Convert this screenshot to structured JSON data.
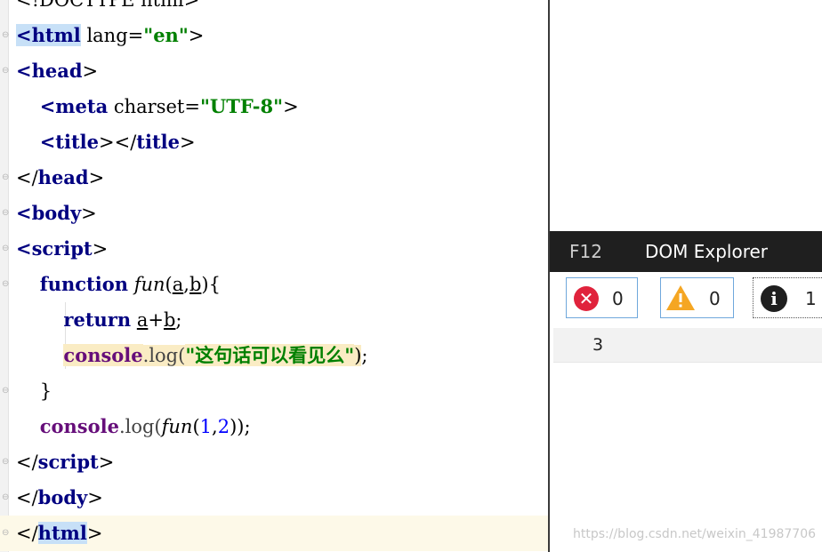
{
  "editor": {
    "lines": [
      {
        "fold": "",
        "parts": [
          [
            "attr",
            "<!DOCTYPE html>"
          ]
        ]
      },
      {
        "fold": "⊖",
        "parts": [
          [
            "tag tag-sel",
            "<html"
          ],
          [
            "attr",
            " lang="
          ],
          [
            "str",
            "\"en\""
          ],
          [
            "attr",
            ">"
          ]
        ]
      },
      {
        "fold": "⊖",
        "parts": [
          [
            "tag",
            "<head"
          ],
          [
            "attr",
            ">"
          ]
        ]
      },
      {
        "fold": "",
        "parts": [
          [
            "attr",
            "    "
          ],
          [
            "tag",
            "<meta"
          ],
          [
            "attr",
            " charset="
          ],
          [
            "str",
            "\"UTF-8\""
          ],
          [
            "attr",
            ">"
          ]
        ]
      },
      {
        "fold": "",
        "parts": [
          [
            "attr",
            "    "
          ],
          [
            "tag",
            "<title"
          ],
          [
            "attr",
            "></"
          ],
          [
            "tag",
            "title"
          ],
          [
            "attr",
            ">"
          ]
        ]
      },
      {
        "fold": "⊖",
        "parts": [
          [
            "attr",
            "</"
          ],
          [
            "tag",
            "head"
          ],
          [
            "attr",
            ">"
          ]
        ]
      },
      {
        "fold": "⊖",
        "parts": [
          [
            "tag",
            "<body"
          ],
          [
            "attr",
            ">"
          ]
        ]
      },
      {
        "fold": "⊖",
        "parts": [
          [
            "tag",
            "<script"
          ],
          [
            "attr",
            ">"
          ]
        ]
      },
      {
        "fold": "⊖",
        "parts": [
          [
            "attr",
            "    "
          ],
          [
            "kw",
            "function"
          ],
          [
            "attr",
            " "
          ],
          [
            "fn-it",
            "fun"
          ],
          [
            "attr",
            "("
          ],
          [
            "param",
            "a"
          ],
          [
            "attr",
            ","
          ],
          [
            "param",
            "b"
          ],
          [
            "attr",
            "){"
          ]
        ]
      },
      {
        "fold": "",
        "parts": [
          [
            "attr",
            "        "
          ],
          [
            "kw",
            "return"
          ],
          [
            "attr",
            " "
          ],
          [
            "param",
            "a"
          ],
          [
            "attr",
            "+"
          ],
          [
            "param",
            "b"
          ],
          [
            "attr",
            ";"
          ]
        ]
      },
      {
        "fold": "",
        "parts": [
          [
            "attr",
            "        "
          ],
          [
            "con cons-hl",
            "console"
          ],
          [
            "meth cons-hl",
            ".log("
          ],
          [
            "str cons-hl",
            "\"这句话可以看见么\""
          ],
          [
            "attr cons-hl",
            ")"
          ],
          [
            "attr",
            ";"
          ]
        ]
      },
      {
        "fold": "⊖",
        "parts": [
          [
            "attr",
            "    }"
          ]
        ]
      },
      {
        "fold": "",
        "parts": [
          [
            "attr",
            "    "
          ],
          [
            "con",
            "console"
          ],
          [
            "meth",
            ".log("
          ],
          [
            "fn-it",
            "fun"
          ],
          [
            "attr",
            "("
          ],
          [
            "num",
            "1"
          ],
          [
            "attr",
            ","
          ],
          [
            "num",
            "2"
          ],
          [
            "attr",
            "));"
          ]
        ]
      },
      {
        "fold": "⊖",
        "parts": [
          [
            "attr",
            "</"
          ],
          [
            "tag",
            "script"
          ],
          [
            "attr",
            ">"
          ]
        ]
      },
      {
        "fold": "⊖",
        "parts": [
          [
            "attr",
            "</"
          ],
          [
            "tag",
            "body"
          ],
          [
            "attr",
            ">"
          ]
        ]
      },
      {
        "fold": "⊖",
        "parts": [
          [
            "attr",
            "</"
          ],
          [
            "tag tag-sel",
            "html"
          ],
          [
            "attr",
            ">"
          ]
        ]
      }
    ]
  },
  "devtools": {
    "tabs": {
      "f12": "F12",
      "dom": "DOM Explorer"
    },
    "filters": {
      "errors": "0",
      "warnings": "0",
      "info": "1"
    },
    "icons": {
      "error": "error-icon",
      "warning": "warning-icon",
      "info": "info-icon"
    },
    "output": "3"
  },
  "watermark": "https://blog.csdn.net/weixin_41987706",
  "colors": {
    "tag": "#000080",
    "string": "#008000",
    "number": "#0000ff",
    "console": "#660e7a",
    "error": "#e0233c",
    "warning": "#f5a623"
  }
}
